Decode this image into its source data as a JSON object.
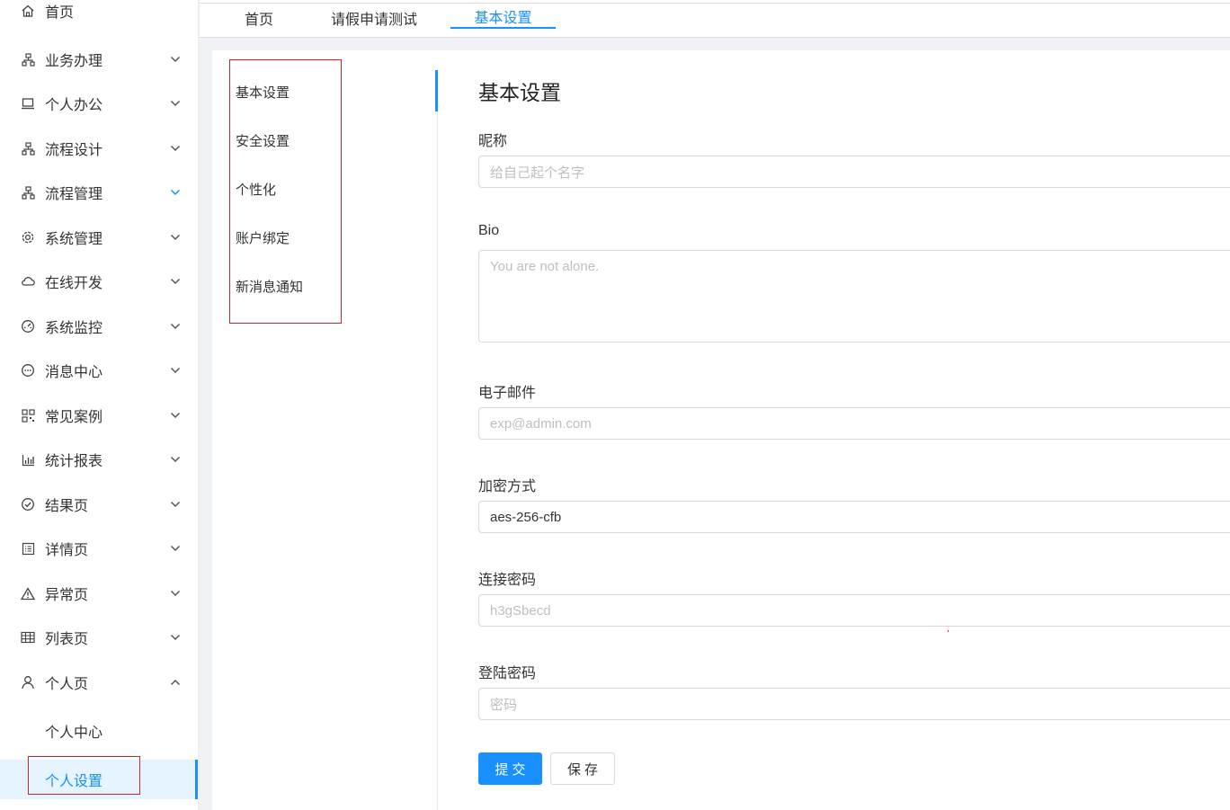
{
  "sidebar": {
    "items": [
      {
        "label": "首页",
        "icon": "home-icon"
      },
      {
        "label": "业务办理",
        "icon": "apartment-icon"
      },
      {
        "label": "个人办公",
        "icon": "laptop-icon"
      },
      {
        "label": "流程设计",
        "icon": "apartment-icon"
      },
      {
        "label": "流程管理",
        "icon": "apartment-icon"
      },
      {
        "label": "系统管理",
        "icon": "gear-icon"
      },
      {
        "label": "在线开发",
        "icon": "cloud-icon"
      },
      {
        "label": "系统监控",
        "icon": "dashboard-icon"
      },
      {
        "label": "消息中心",
        "icon": "message-icon"
      },
      {
        "label": "常见案例",
        "icon": "qrcode-icon"
      },
      {
        "label": "统计报表",
        "icon": "bar-chart-icon"
      },
      {
        "label": "结果页",
        "icon": "check-circle-icon"
      },
      {
        "label": "详情页",
        "icon": "profile-icon"
      },
      {
        "label": "异常页",
        "icon": "warning-icon"
      },
      {
        "label": "列表页",
        "icon": "table-icon"
      },
      {
        "label": "个人页",
        "icon": "user-icon"
      }
    ],
    "sub_items": [
      {
        "label": "个人中心"
      },
      {
        "label": "个人设置"
      }
    ]
  },
  "tabs": [
    {
      "label": "首页"
    },
    {
      "label": "请假申请测试"
    },
    {
      "label": "基本设置"
    }
  ],
  "settings_menu": [
    "基本设置",
    "安全设置",
    "个性化",
    "账户绑定",
    "新消息通知"
  ],
  "form": {
    "title": "基本设置",
    "nickname": {
      "label": "昵称",
      "placeholder": "给自己起个名字"
    },
    "bio": {
      "label": "Bio",
      "placeholder": "You are not alone."
    },
    "email": {
      "label": "电子邮件",
      "placeholder": "exp@admin.com"
    },
    "encryption": {
      "label": "加密方式",
      "value": "aes-256-cfb"
    },
    "conn_password": {
      "label": "连接密码",
      "placeholder": "h3gSbecd"
    },
    "login_password": {
      "label": "登陆密码",
      "placeholder": "密码"
    },
    "submit_label": "提交",
    "save_label": "保存"
  },
  "colors": {
    "accent": "#1890ff",
    "highlight_box": "#e02020"
  }
}
